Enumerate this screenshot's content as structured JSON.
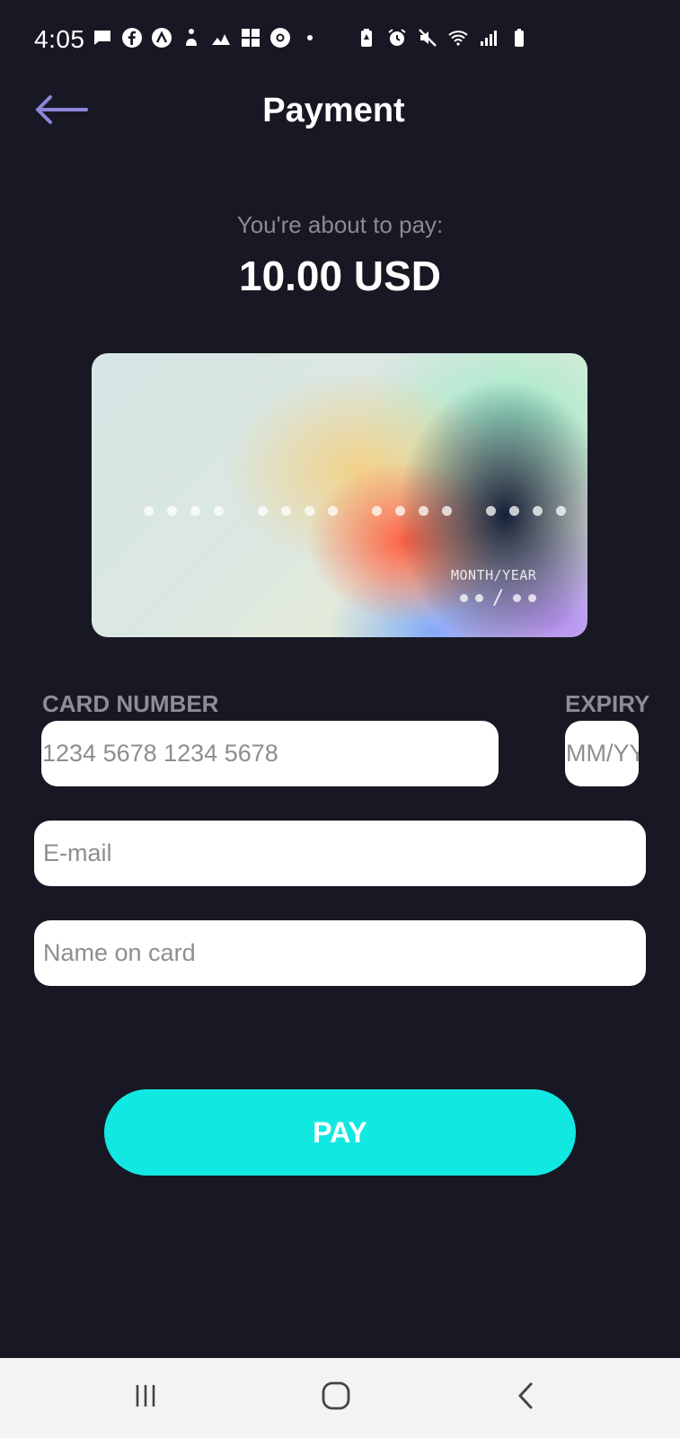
{
  "status_bar": {
    "time": "4:05",
    "left_icons": [
      "message-icon",
      "facebook-icon",
      "app-a-icon",
      "app-figure-icon",
      "app-chart-icon",
      "app-grid-icon",
      "chrome-icon",
      "more-dot-icon"
    ],
    "right_icons": [
      "battery-saver-icon",
      "alarm-icon",
      "mute-icon",
      "wifi-icon",
      "signal-icon",
      "battery-icon"
    ]
  },
  "header": {
    "title": "Payment",
    "back_icon": "arrow-left-icon"
  },
  "summary": {
    "caption": "You're about to pay:",
    "amount": "10.00 USD"
  },
  "card_preview": {
    "expiry_label": "MONTH/YEAR",
    "expiry_separator": "/"
  },
  "form": {
    "card_number_label": "CARD NUMBER",
    "card_number_placeholder": "1234 5678 1234 5678",
    "expiry_label": "EXPIRY",
    "expiry_placeholder": "MM/YY",
    "email_placeholder": "E-mail",
    "name_placeholder": "Name on card"
  },
  "pay_button": {
    "label": "PAY"
  },
  "nav_bar": {
    "recents_icon": "recents-icon",
    "home_icon": "home-icon",
    "back_icon": "back-icon"
  },
  "colors": {
    "background": "#181824",
    "accent_button": "#12e8e2",
    "back_arrow": "#8b86d8",
    "label_gray": "#8d8d95"
  }
}
